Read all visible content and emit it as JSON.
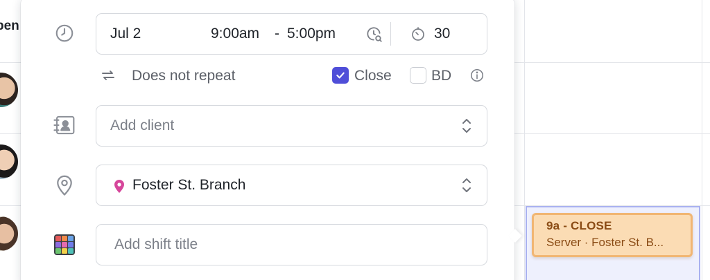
{
  "background": {
    "partial_header": "pen"
  },
  "time": {
    "date": "Jul 2",
    "start": "9:00am",
    "separator": "-",
    "end": "5:00pm",
    "break_minutes": "30"
  },
  "repeat": {
    "label": "Does not repeat",
    "close_label": "Close",
    "close_checked": true,
    "bd_label": "BD",
    "bd_checked": false
  },
  "client": {
    "placeholder": "Add client"
  },
  "location": {
    "value": "Foster St. Branch",
    "pin_color": "#d6469b"
  },
  "shift_title": {
    "placeholder": "Add shift title"
  },
  "shift_card": {
    "title": "9a - CLOSE",
    "subtitle": "Server · Foster St. B..."
  },
  "colors": {
    "accent": "#4f4ed8",
    "shift_fill": "#fbdcb4",
    "shift_border": "#f1b673",
    "shift_text": "#8a4b14"
  }
}
